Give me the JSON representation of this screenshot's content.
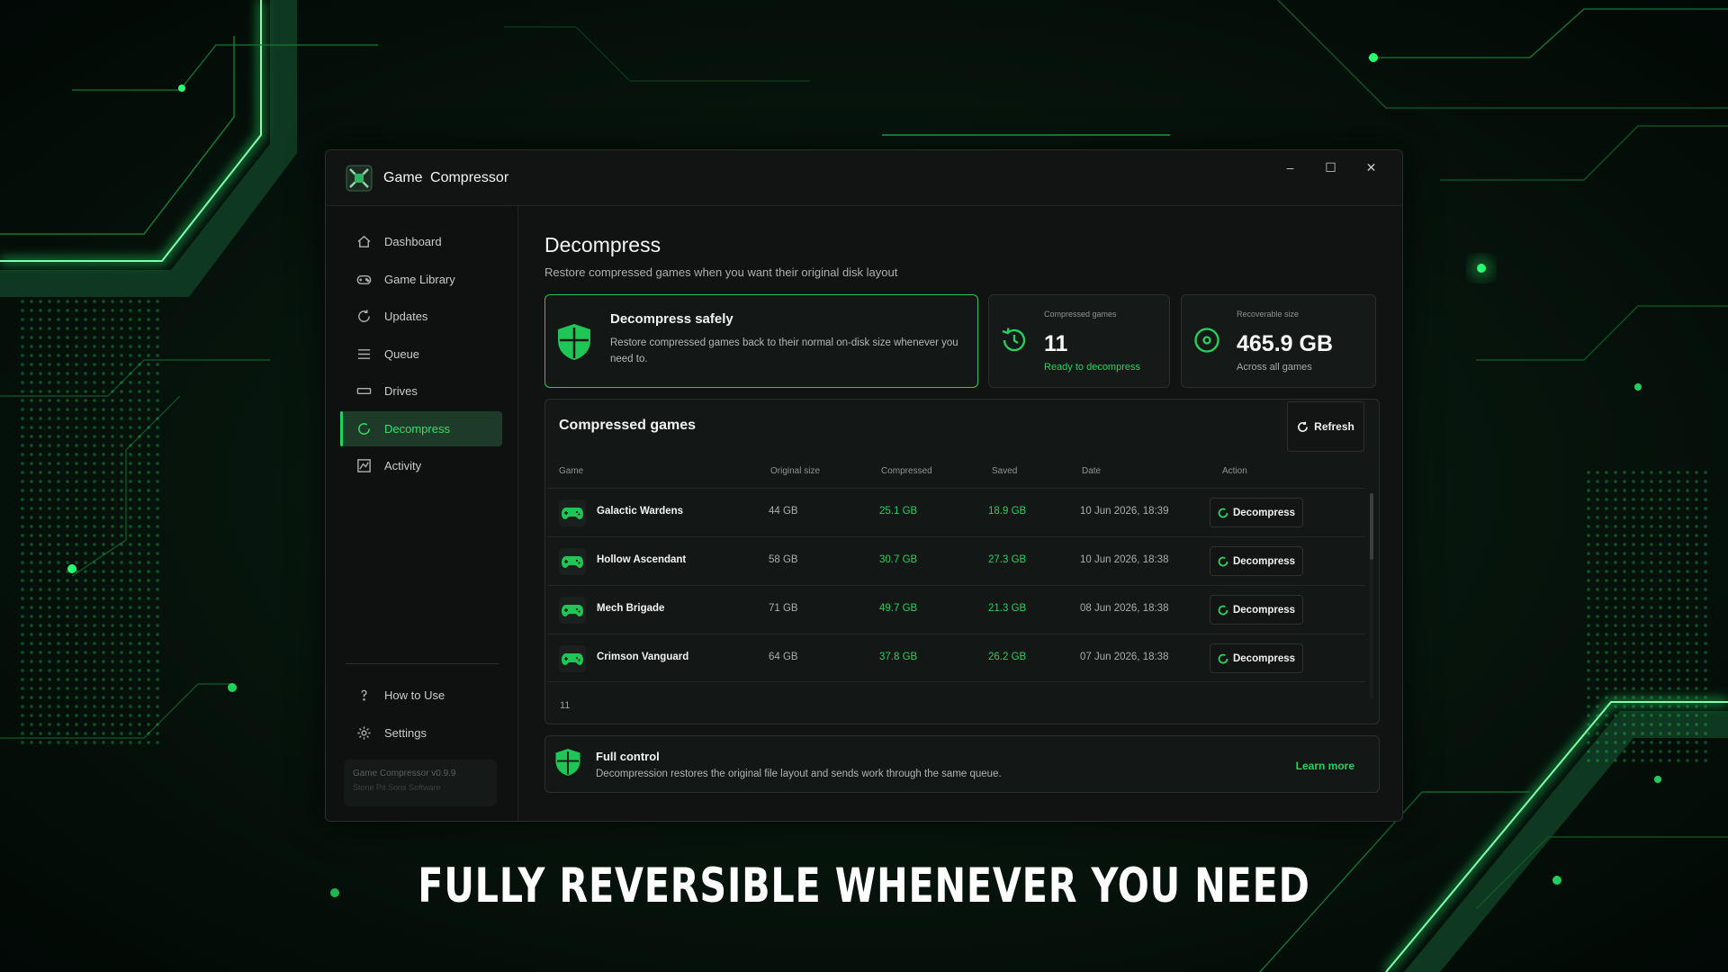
{
  "app": {
    "title": "Game  Compressor"
  },
  "window_controls": {
    "minimize": "–",
    "maximize": "☐",
    "close": "✕"
  },
  "sidebar": {
    "items": [
      {
        "label": "Dashboard",
        "icon": "home-icon"
      },
      {
        "label": "Game Library",
        "icon": "gamepad-icon"
      },
      {
        "label": "Updates",
        "icon": "refresh-icon"
      },
      {
        "label": "Queue",
        "icon": "list-icon"
      },
      {
        "label": "Drives",
        "icon": "drive-icon"
      },
      {
        "label": "Decompress",
        "icon": "decompress-icon",
        "active": true
      },
      {
        "label": "Activity",
        "icon": "activity-icon"
      }
    ],
    "bottom_items": [
      {
        "label": "How to Use",
        "icon": "question-icon"
      },
      {
        "label": "Settings",
        "icon": "gear-icon"
      }
    ],
    "version": {
      "title": "Game Compressor v0.9.9",
      "subtitle": "Stone Pit Sons Software"
    }
  },
  "page": {
    "title": "Decompress",
    "subtitle": "Restore compressed games when you want their original disk layout"
  },
  "hero": {
    "title": "Decompress safely",
    "text": "Restore compressed games back to their normal on-disk size whenever you need to."
  },
  "stats": [
    {
      "label": "Compressed games",
      "value": "11",
      "note": "Ready to decompress"
    },
    {
      "label": "Recoverable size",
      "value": "465.9 GB",
      "note": "Across all games"
    }
  ],
  "table": {
    "title": "Compressed games",
    "refresh_label": "Refresh",
    "columns": [
      "Game",
      "Original size",
      "Compressed",
      "Saved",
      "Date",
      "Action"
    ],
    "rows": [
      {
        "game": "Galactic Wardens",
        "original": "44 GB",
        "compressed": "25.1 GB",
        "saved": "18.9 GB",
        "date": "10 Jun 2026, 18:39",
        "action": "Decompress"
      },
      {
        "game": "Hollow Ascendant",
        "original": "58 GB",
        "compressed": "30.7 GB",
        "saved": "27.3 GB",
        "date": "10 Jun 2026, 18:38",
        "action": "Decompress"
      },
      {
        "game": "Mech Brigade",
        "original": "71 GB",
        "compressed": "49.7 GB",
        "saved": "21.3 GB",
        "date": "08 Jun 2026, 18:38",
        "action": "Decompress"
      },
      {
        "game": "Crimson Vanguard",
        "original": "64 GB",
        "compressed": "37.8 GB",
        "saved": "26.2 GB",
        "date": "07 Jun 2026, 18:38",
        "action": "Decompress"
      }
    ],
    "footer_count": "11"
  },
  "footer_card": {
    "title": "Full control",
    "text": "Decompression restores the original file layout and sends work through the same queue.",
    "link": "Learn more"
  },
  "caption": "FULLY REVERSIBLE WHENEVER YOU NEED",
  "colors": {
    "accent": "#22d35d",
    "background": "#06140c",
    "panel": "#101312"
  }
}
